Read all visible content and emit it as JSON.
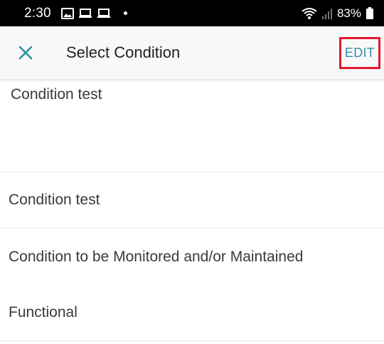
{
  "status_bar": {
    "time": "2:30",
    "battery_percent": "83%",
    "left_icons": [
      "image-icon",
      "laptop-icon",
      "laptop-icon",
      "dot-icon"
    ],
    "right_icons": [
      "wifi-icon",
      "signal-icon",
      "battery-icon"
    ]
  },
  "app_bar": {
    "title": "Select Condition",
    "close_icon": "close-icon",
    "edit_label": "EDIT",
    "accent_color": "#2b8fa8",
    "highlight_color": "#e0192c"
  },
  "conditions": [
    {
      "label": "Condition test"
    },
    {
      "label": "Condition test"
    },
    {
      "label": "Condition to be Monitored and/or Maintained"
    },
    {
      "label": "Functional"
    }
  ]
}
